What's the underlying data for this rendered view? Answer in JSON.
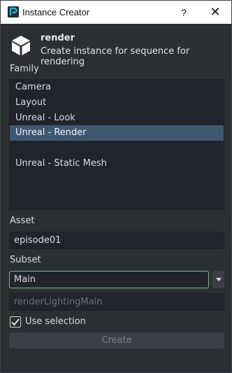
{
  "window": {
    "title": "Instance Creator",
    "help_label": "?",
    "close_label": "✕"
  },
  "header": {
    "title": "render",
    "subtitle": "Create instance for sequence for rendering",
    "icon": "cube-icon"
  },
  "family": {
    "label": "Family",
    "items": [
      "Camera",
      "Layout",
      "Unreal - Look",
      "Unreal - Render",
      "Unreal - Static Mesh"
    ],
    "selected": "Unreal - Render"
  },
  "asset": {
    "label": "Asset",
    "value": "episode01"
  },
  "subset": {
    "label": "Subset",
    "value": "Main",
    "result_placeholder": "renderLightingMain"
  },
  "options": {
    "use_selection_label": "Use selection",
    "use_selection_checked": true
  },
  "actions": {
    "create_label": "Create"
  },
  "colors": {
    "background": "#2b2e33",
    "selection": "#3e5870",
    "active_border": "#7fb98a"
  }
}
